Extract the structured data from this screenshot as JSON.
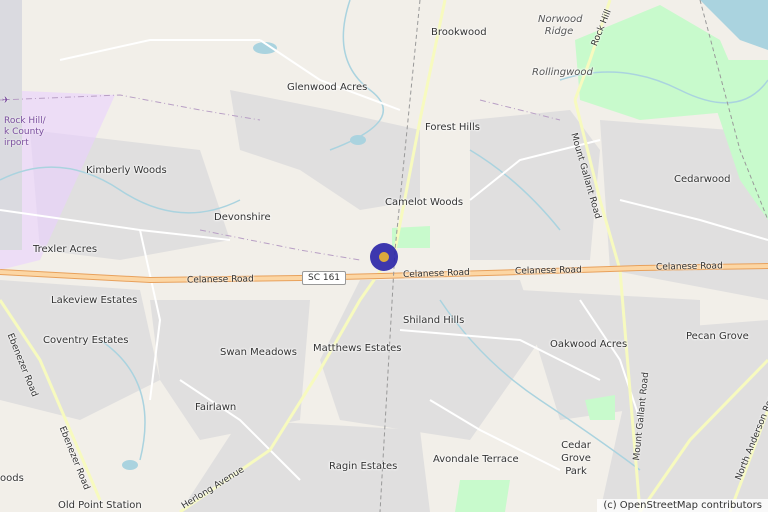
{
  "map": {
    "places": [
      {
        "id": "brookwood",
        "label": "Brookwood"
      },
      {
        "id": "norwood-ridge",
        "label": "Norwood Ridge"
      },
      {
        "id": "rollingwood",
        "label": "Rollingwood"
      },
      {
        "id": "glenwood-acres",
        "label": "Glenwood Acres"
      },
      {
        "id": "forest-hills",
        "label": "Forest Hills"
      },
      {
        "id": "kimberly-woods",
        "label": "Kimberly Woods"
      },
      {
        "id": "camelot-woods",
        "label": "Camelot Woods"
      },
      {
        "id": "cedarwood",
        "label": "Cedarwood"
      },
      {
        "id": "devonshire",
        "label": "Devonshire"
      },
      {
        "id": "trexler-acres",
        "label": "Trexler Acres"
      },
      {
        "id": "lakeview-estates",
        "label": "Lakeview Estates"
      },
      {
        "id": "shiland-hills",
        "label": "Shiland Hills"
      },
      {
        "id": "coventry-estates",
        "label": "Coventry Estates"
      },
      {
        "id": "matthews-estates",
        "label": "Matthews Estates"
      },
      {
        "id": "oakwood-acres",
        "label": "Oakwood Acres"
      },
      {
        "id": "pecan-grove",
        "label": "Pecan Grove"
      },
      {
        "id": "swan-meadows",
        "label": "Swan Meadows"
      },
      {
        "id": "fairlawn",
        "label": "Fairlawn"
      },
      {
        "id": "cedar-grove-park",
        "label": "Cedar Grove Park"
      },
      {
        "id": "avondale-terrace",
        "label": "Avondale Terrace"
      },
      {
        "id": "ragin-estates",
        "label": "Ragin Estates"
      },
      {
        "id": "odds",
        "label": "oods"
      },
      {
        "id": "old-point-station",
        "label": "Old Point Station"
      }
    ],
    "roads": {
      "celanese_1": "Celanese Road",
      "celanese_2": "Celanese Road",
      "celanese_3": "Celanese Road",
      "celanese_4": "Celanese Road",
      "shield": "SC 161",
      "ebenezer_1": "Ebenezer Road",
      "ebenezer_2": "Ebenezer Road",
      "mount_gallant_1": "Mount Gallant Road",
      "mount_gallant_2": "Mount Gallant Road",
      "north_anderson": "North Anderson Road",
      "herlong": "Herlong Avenue",
      "rock_hill": "Rock Hill"
    },
    "airport_label": [
      "Rock Hill/",
      "k County",
      "irport"
    ],
    "attribution": "(c) OpenStreetMap contributors",
    "colors": {
      "background": "#f2efe9",
      "residential": "#e0dfdf",
      "park": "#c8facc",
      "water": "#aad3df",
      "primary_road": "#fcd6a4",
      "marker": "#2a24a8",
      "marker_center": "#d9a32b"
    }
  }
}
